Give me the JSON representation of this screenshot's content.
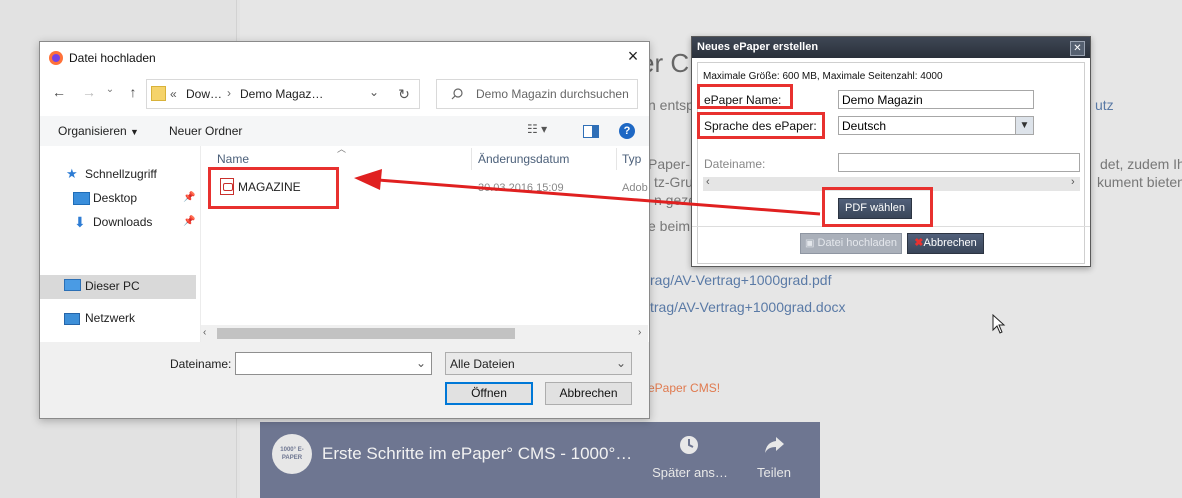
{
  "background": {
    "heading_fragment": "er C",
    "text_lines": [
      "n entsp",
      "Paper-",
      "tz-Gru",
      "n gezei",
      "e beim"
    ],
    "right_texts": [
      "det, zudem Ihre",
      "kument bieten"
    ],
    "link_fragment_1": "utz",
    "links": [
      "rag/AV-Vertrag+1000grad.pdf",
      "trag/AV-Vertrag+1000grad.docx"
    ],
    "orange_text": "ePaper CMS!",
    "video": {
      "logo_text": "1000° E-PAPER",
      "title": "Erste Schritte im ePaper° CMS - 1000°…",
      "watch_later": "Später ans…",
      "share": "Teilen"
    }
  },
  "file_dialog": {
    "title": "Datei hochladen",
    "breadcrumb": {
      "prefix": "«",
      "items": [
        "Dow…",
        "Demo Magaz…"
      ]
    },
    "search_placeholder": "Demo Magazin durchsuchen",
    "toolbar": {
      "organize": "Organisieren",
      "new_folder": "Neuer Ordner"
    },
    "sidebar": {
      "items": [
        {
          "label": "Schnellzugriff",
          "icon": "star-icon"
        },
        {
          "label": "Desktop",
          "icon": "desktop-folder-icon"
        },
        {
          "label": "Downloads",
          "icon": "download-icon"
        },
        {
          "label": "Dieser PC",
          "icon": "computer-icon"
        },
        {
          "label": "Netzwerk",
          "icon": "network-icon"
        }
      ]
    },
    "columns": [
      "Name",
      "Änderungsdatum",
      "Typ"
    ],
    "files": [
      {
        "name": "MAGAZINE",
        "date": "30.03.2016 15:09",
        "type": "Adob"
      }
    ],
    "filename_label": "Dateiname:",
    "filename_value": "",
    "filetype": "Alle Dateien",
    "open_button": "Öffnen",
    "cancel_button": "Abbrechen"
  },
  "epaper_dialog": {
    "title": "Neues ePaper erstellen",
    "limits": "Maximale Größe: 600 MB, Maximale Seitenzahl: 4000",
    "name_label": "ePaper Name:",
    "name_value": "Demo Magazin",
    "lang_label": "Sprache des ePaper:",
    "lang_value": "Deutsch",
    "filename_label": "Dateiname:",
    "filename_value": "",
    "pdf_button": "PDF wählen",
    "upload_button": "Datei hochladen",
    "cancel_button": "Abbrechen"
  },
  "colors": {
    "highlight_red": "#e8312f",
    "arrow_red": "#e02020",
    "link_blue": "#5a7aa6"
  }
}
